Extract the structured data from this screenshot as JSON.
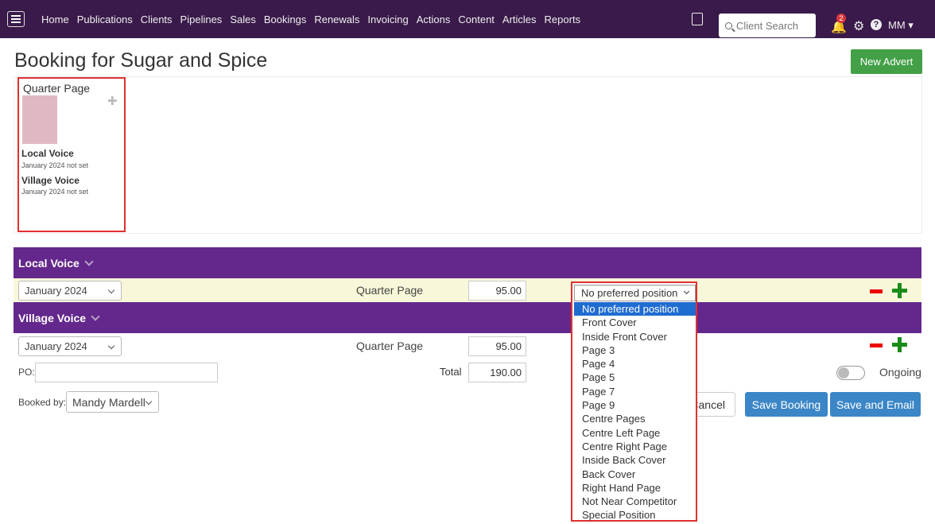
{
  "nav": {
    "items": [
      "Home",
      "Publications",
      "Clients",
      "Pipelines",
      "Sales",
      "Bookings",
      "Renewals",
      "Invoicing",
      "Actions",
      "Content",
      "Articles",
      "Reports"
    ],
    "search_placeholder": "Client Search",
    "notification_count": "2",
    "user": "MM ▾"
  },
  "page": {
    "title": "Booking for Sugar and Spice",
    "new_advert_label": "New Advert"
  },
  "ad_card": {
    "size": "Quarter Page",
    "thumb_color": "#e0b8c4",
    "entries": [
      {
        "publication": "Local Voice",
        "status": "January 2024 not set"
      },
      {
        "publication": "Village Voice",
        "status": "January 2024 not set"
      }
    ]
  },
  "publications": [
    {
      "name": "Local Voice",
      "issue": "January 2024",
      "size": "Quarter Page",
      "price": "95.00",
      "position": "No preferred position"
    },
    {
      "name": "Village Voice",
      "issue": "January 2024",
      "size": "Quarter Page",
      "price": "95.00"
    }
  ],
  "footer": {
    "po_label": "PO:",
    "total_label": "Total",
    "total_value": "190.00",
    "ongoing_label": "Ongoing",
    "ongoing_on": false,
    "booked_by_label": "Booked by:",
    "booked_by_value": "Mandy Mardell",
    "cancel_label": "Cancel",
    "save_booking_label": "Save Booking",
    "save_email_label": "Save and Email"
  },
  "position_dropdown": {
    "current": "No preferred position",
    "options": [
      "No preferred position",
      "Front Cover",
      "Inside Front Cover",
      "Page 3",
      "Page 4",
      "Page 5",
      "Page 7",
      "Page 9",
      "Centre Pages",
      "Centre Left Page",
      "Centre Right Page",
      "Inside Back Cover",
      "Back Cover",
      "Right Hand Page",
      "Not Near Competitor",
      "Special Position"
    ],
    "selected_index": 0
  },
  "colors": {
    "topbar": "#3a1a4a",
    "band": "#64288c",
    "accent_blue": "#3b86c6",
    "green": "#43a047"
  }
}
